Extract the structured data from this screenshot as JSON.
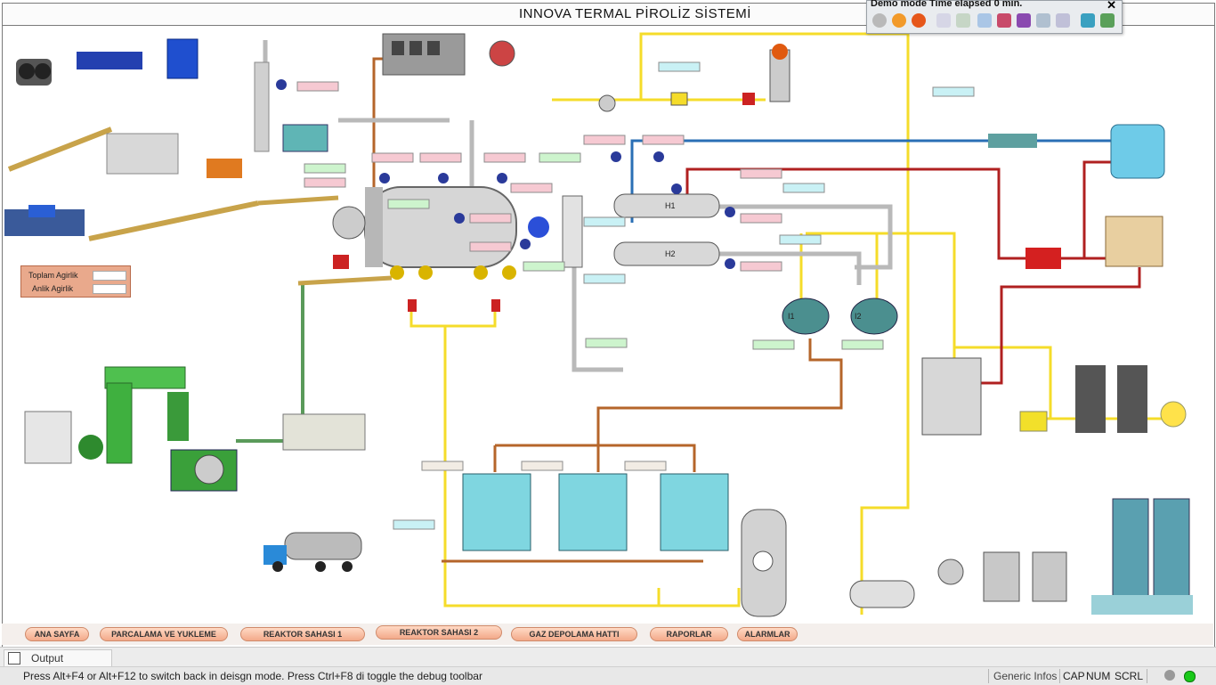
{
  "window": {
    "title": "INNOVA TERMAL  PİROLİZ SİSTEMİ"
  },
  "demo_toolbar": {
    "text": "Demo mode Time elapsed  0  min.",
    "close": "✕"
  },
  "weights": {
    "total_label": "Toplam Agirlik",
    "instant_label": "Anlik Agirlik"
  },
  "units": {
    "h1": "H1",
    "h2": "H2",
    "i1": "I1",
    "i2": "I2"
  },
  "tabs": [
    "ANA SAYFA",
    "PARCALAMA VE YUKLEME",
    "REAKTOR SAHASI 1",
    "REAKTOR SAHASI 2",
    "GAZ DEPOLAMA HATTI",
    "RAPORLAR",
    "ALARMLAR"
  ],
  "output": {
    "tab_label": "Output"
  },
  "status": {
    "message": "Press Alt+F4 or Alt+F12 to switch back in deisgn mode. Press Ctrl+F8 di toggle the debug toolbar",
    "generic": "Generic Infos",
    "cap": "CAP",
    "num": "NUM",
    "scrl": "SCRL"
  },
  "colors": {
    "pipe_yellow": "#f5dc2a",
    "pipe_brown": "#b5652a",
    "pipe_red": "#b02020",
    "pipe_blue": "#2a6fb5",
    "tab_fill": "#f3a98a"
  }
}
